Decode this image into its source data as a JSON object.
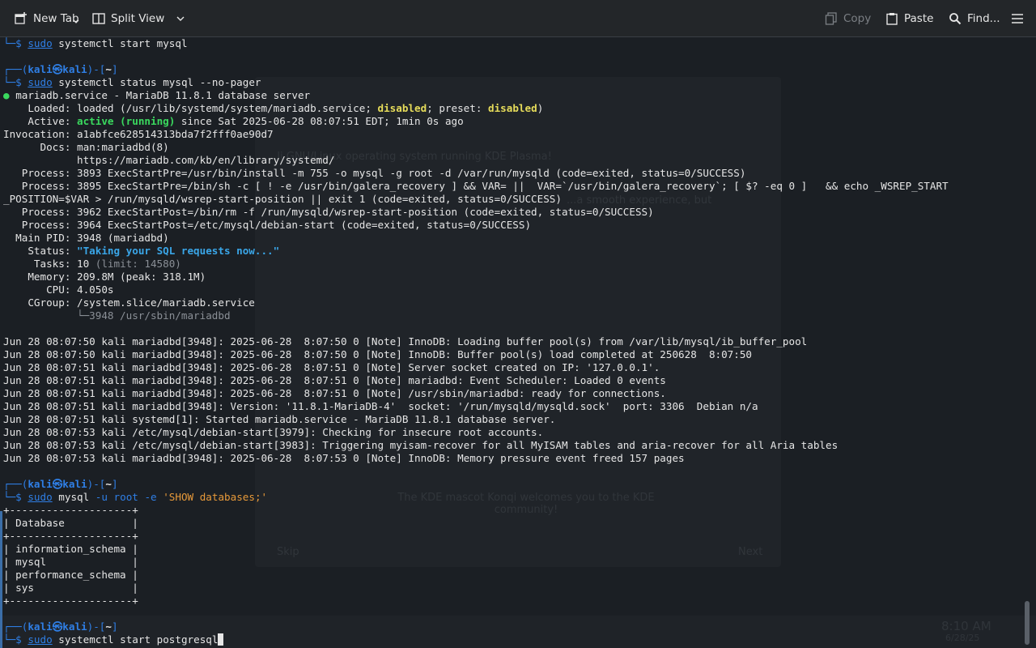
{
  "toolbar": {
    "new_tab": "New Tab",
    "split_view": "Split View",
    "copy": "Copy",
    "paste": "Paste",
    "find": "Find..."
  },
  "prompt": {
    "user": "kali",
    "sep": "㉿",
    "host": "kali",
    "dir": "~"
  },
  "commands": {
    "c0": "start mysql",
    "c1": "status mysql --no-pager",
    "c2_args": "-u root -e",
    "c2_str": "'SHOW databases;'",
    "c3": "start postgresql"
  },
  "status": {
    "title": "mariadb.service - MariaDB 11.8.1 database server",
    "loaded_pre": "    Loaded: loaded (/usr/lib/systemd/system/mariadb.service; ",
    "loaded_disabled1": "disabled",
    "loaded_mid": "; preset: ",
    "loaded_disabled2": "disabled",
    "loaded_post": ")",
    "active_pre": "    Active: ",
    "active_state": "active (running)",
    "active_post": " since Sat 2025-06-28 08:07:51 EDT; 1min 0s ago",
    "invocation": "Invocation: a1abfce628514313bda7f2fff0ae90d7",
    "docs1": "      Docs: man:mariadbd(8)",
    "docs2": "            https://mariadb.com/kb/en/library/systemd/",
    "proc1": "   Process: 3893 ExecStartPre=/usr/bin/install -m 755 -o mysql -g root -d /var/run/mysqld (code=exited, status=0/SUCCESS)",
    "proc2": "   Process: 3895 ExecStartPre=/bin/sh -c [ ! -e /usr/bin/galera_recovery ] && VAR= ||  VAR=`/usr/bin/galera_recovery`; [ $? -eq 0 ]   && echo _WSREP_START",
    "proc2b": "_POSITION=$VAR > /run/mysqld/wsrep-start-position || exit 1 (code=exited, status=0/SUCCESS)",
    "proc3": "   Process: 3962 ExecStartPost=/bin/rm -f /run/mysqld/wsrep-start-position (code=exited, status=0/SUCCESS)",
    "proc4": "   Process: 3964 ExecStartPost=/etc/mysql/debian-start (code=exited, status=0/SUCCESS)",
    "mainpid": "  Main PID: 3948 (mariadbd)",
    "status_pre": "    Status: ",
    "status_val": "\"Taking your SQL requests now...\"",
    "tasks_pre": "     Tasks: 10 ",
    "tasks_limit": "(limit: 14580)",
    "memory": "    Memory: 209.8M (peak: 318.1M)",
    "cpu": "       CPU: 4.050s",
    "cgroup": "    CGroup: /system.slice/mariadb.service",
    "cgroup_child": "            └─3948 /usr/sbin/mariadbd"
  },
  "log": [
    "Jun 28 08:07:50 kali mariadbd[3948]: 2025-06-28  8:07:50 0 [Note] InnoDB: Loading buffer pool(s) from /var/lib/mysql/ib_buffer_pool",
    "Jun 28 08:07:50 kali mariadbd[3948]: 2025-06-28  8:07:50 0 [Note] InnoDB: Buffer pool(s) load completed at 250628  8:07:50",
    "Jun 28 08:07:51 kali mariadbd[3948]: 2025-06-28  8:07:51 0 [Note] Server socket created on IP: '127.0.0.1'.",
    "Jun 28 08:07:51 kali mariadbd[3948]: 2025-06-28  8:07:51 0 [Note] mariadbd: Event Scheduler: Loaded 0 events",
    "Jun 28 08:07:51 kali mariadbd[3948]: 2025-06-28  8:07:51 0 [Note] /usr/sbin/mariadbd: ready for connections.",
    "Jun 28 08:07:51 kali mariadbd[3948]: Version: '11.8.1-MariaDB-4'  socket: '/run/mysqld/mysqld.sock'  port: 3306  Debian n/a",
    "Jun 28 08:07:51 kali systemd[1]: Started mariadb.service - MariaDB 11.8.1 database server.",
    "Jun 28 08:07:53 kali /etc/mysql/debian-start[3979]: Checking for insecure root accounts.",
    "Jun 28 08:07:53 kali /etc/mysql/debian-start[3983]: Triggering myisam-recover for all MyISAM tables and aria-recover for all Aria tables",
    "Jun 28 08:07:53 kali mariadbd[3948]: 2025-06-28  8:07:53 0 [Note] InnoDB: Memory pressure event freed 157 pages"
  ],
  "table": {
    "border": "+--------------------+",
    "header": "| Database           |",
    "rows": [
      "| information_schema |",
      "| mysql              |",
      "| performance_schema |",
      "| sys                |"
    ]
  },
  "ghost": {
    "kde_os": "...li GNU/Linux operating system running KDE Plasma!",
    "smooth": "...a smooth experience, but",
    "mascot": "The KDE mascot Konqi welcomes you to the KDE community!",
    "skip": "Skip",
    "next": "Next",
    "clock": "8:10 AM",
    "date": "6/28/25"
  }
}
